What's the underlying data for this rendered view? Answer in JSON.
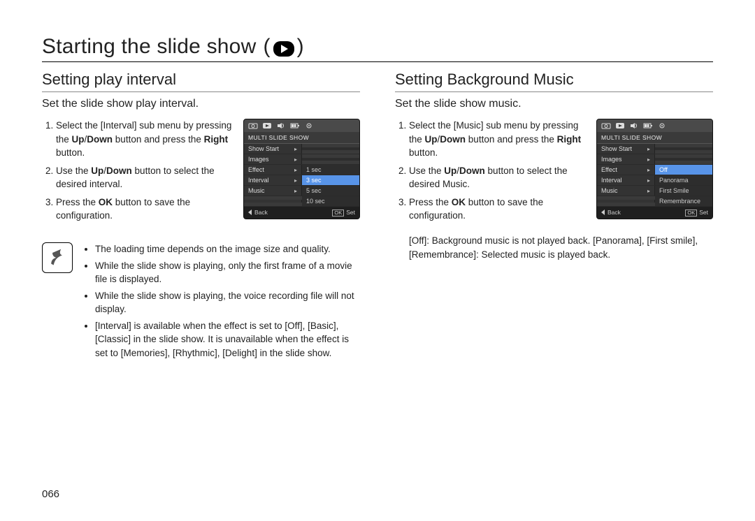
{
  "page_number": "066",
  "title": "Starting the slide show",
  "title_paren_open": "(",
  "title_paren_close": ")",
  "left": {
    "heading": "Setting play interval",
    "intro": "Set the slide show play interval.",
    "steps": [
      "Select the [Interval] sub menu by pressing the Up/Down button and press the Right button.",
      "Use the Up/Down button to select the desired interval.",
      "Press the OK button to save the configuration."
    ],
    "lcd": {
      "heading": "MULTI SLIDE SHOW",
      "menu": [
        {
          "label": "Show Start",
          "value": ""
        },
        {
          "label": "Images",
          "value": ""
        },
        {
          "label": "Effect",
          "value": "1 sec"
        },
        {
          "label": "Interval",
          "value": "3 sec",
          "selected": true
        },
        {
          "label": "Music",
          "value": "5 sec"
        },
        {
          "label": "",
          "value": "10 sec"
        }
      ],
      "footer_back": "Back",
      "footer_ok": "OK",
      "footer_set": "Set"
    },
    "notes": [
      "The loading time depends on the image size and quality.",
      "While the slide show is playing, only the first frame of a movie file is displayed.",
      "While the slide show is playing, the voice recording file will not display.",
      "[Interval] is available when the effect is set to [Off], [Basic], [Classic] in the slide show. It is unavailable when the effect is set to [Memories], [Rhythmic], [Delight] in the slide show."
    ]
  },
  "right": {
    "heading": "Setting Background Music",
    "intro": "Set the slide show music.",
    "steps": [
      "Select the [Music] sub menu by pressing the Up/Down button and press the Right button.",
      "Use the Up/Down button to select the desired Music.",
      "Press the OK button to save the configuration."
    ],
    "lcd": {
      "heading": "MULTI SLIDE SHOW",
      "menu": [
        {
          "label": "Show Start",
          "value": ""
        },
        {
          "label": "Images",
          "value": ""
        },
        {
          "label": "Effect",
          "value": "Off",
          "selected": true
        },
        {
          "label": "Interval",
          "value": "Panorama"
        },
        {
          "label": "Music",
          "value": "First Smile"
        },
        {
          "label": "",
          "value": "Remembrance"
        }
      ],
      "footer_back": "Back",
      "footer_ok": "OK",
      "footer_set": "Set"
    },
    "extra_note": "[Off]: Background music is not played back. [Panorama], [First smile], [Remembrance]: Selected music is played back."
  }
}
